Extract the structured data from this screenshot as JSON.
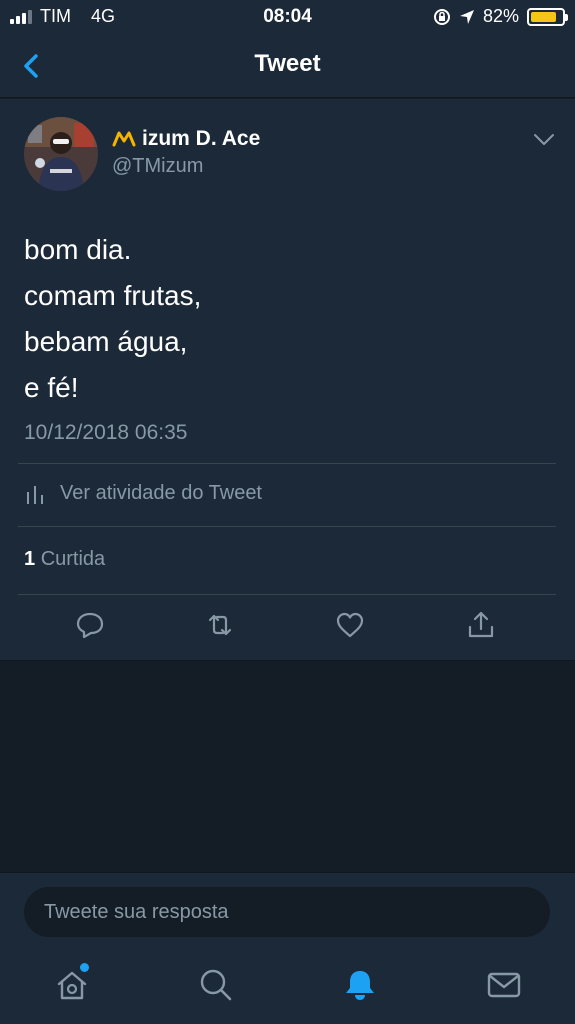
{
  "status_bar": {
    "carrier": "TIM",
    "network": "4G",
    "time": "08:04",
    "battery_percent": "82%",
    "battery_level": 0.82,
    "battery_color": "#f5c518"
  },
  "nav": {
    "back_icon": "chevron-left-icon",
    "title": "Tweet"
  },
  "tweet": {
    "author_name": "izum D. Ace",
    "author_name_prefix_icon": "yellow-m-emoji-icon",
    "handle": "@TMizum",
    "text_lines": [
      "bom dia.",
      "comam frutas,",
      "bebam água,",
      "e fé!"
    ],
    "timestamp": "10/12/2018 06:35",
    "activity_label": "Ver atividade do Tweet",
    "like_count": "1",
    "like_label": "Curtida",
    "actions": [
      "reply-icon",
      "retweet-icon",
      "like-icon",
      "share-icon"
    ]
  },
  "reply_box": {
    "placeholder": "Tweete sua resposta"
  },
  "tab_bar": {
    "tabs": [
      "home-icon",
      "search-icon",
      "notifications-icon",
      "messages-icon"
    ],
    "active": "notifications-icon"
  },
  "colors": {
    "accent": "#1da1f2",
    "background": "#141c26",
    "card": "#1c2938",
    "secondary_text": "#8899a6"
  }
}
